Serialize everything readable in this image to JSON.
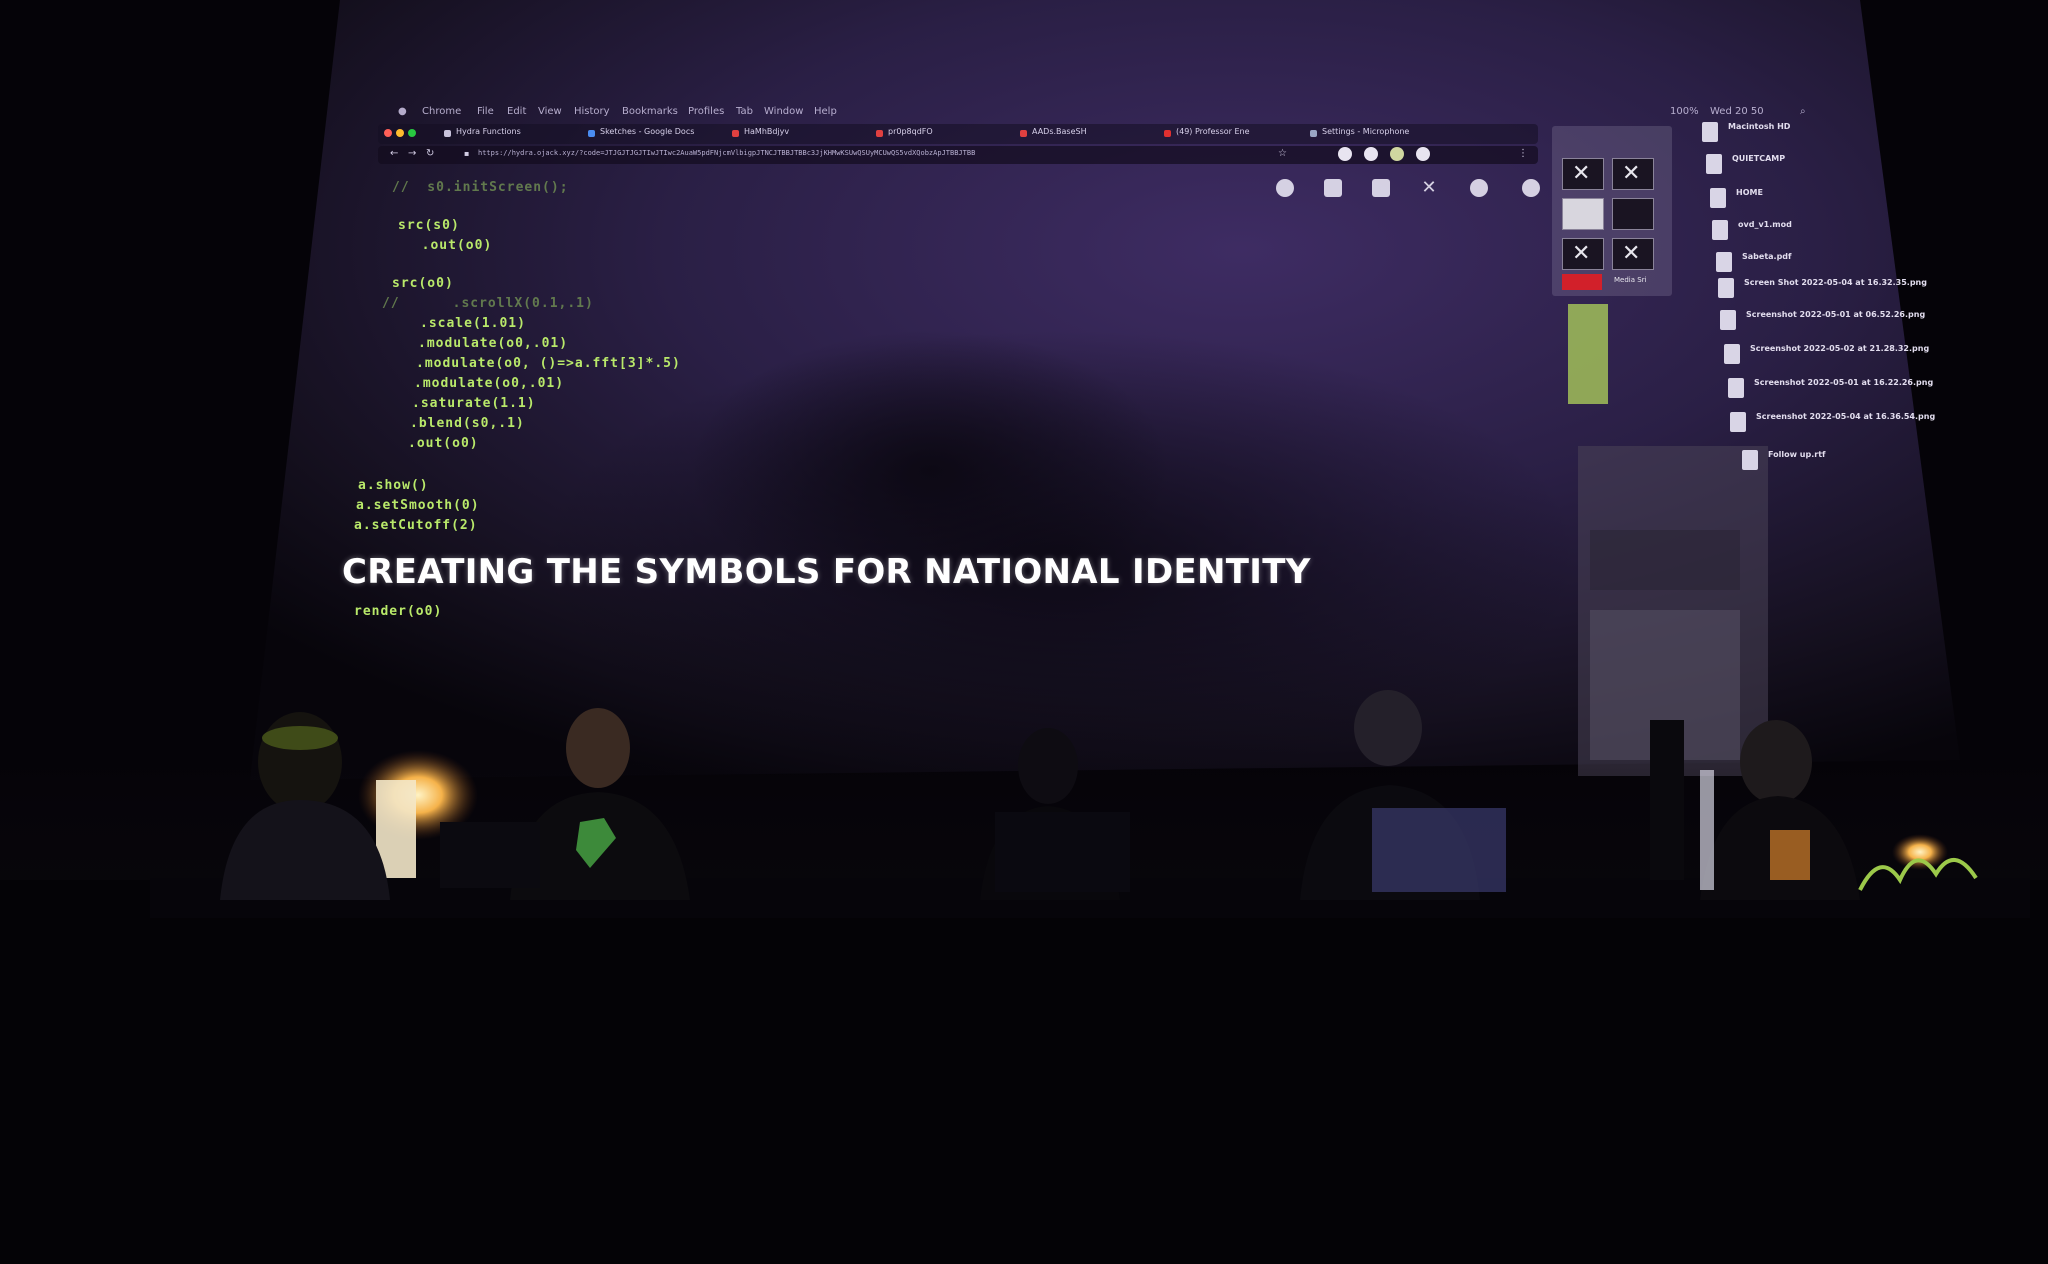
{
  "menubar": {
    "items": [
      "Chrome",
      "File",
      "Edit",
      "View",
      "History",
      "Bookmarks",
      "Profiles",
      "Tab",
      "Window",
      "Help"
    ],
    "status": [
      "100%",
      "Wed 20 50"
    ]
  },
  "browser": {
    "tabs": [
      "Hydra Functions",
      "Sketches - Google Docs",
      "HaMhBdjyv",
      "pr0p8qdFO",
      "AADs.BaseSH",
      "(49) Professor Ene",
      "Settings - Microphone"
    ],
    "url": "https://hydra.ojack.xyz/?code=JTJGJTJGJTIwJTIwc2AuaW5pdFNjcmVlbigpJTNCJTBBJTBBc3JjKHMwKSUwQSUyMCUwQS5vdXQobzApJTBBJTBB"
  },
  "code_lines": [
    {
      "t": "//  s0.initScreen();",
      "cls": "cm"
    },
    {
      "t": "src(s0)",
      "cls": "fn"
    },
    {
      "t": "  .out(o0)",
      "cls": "fn"
    },
    {
      "t": "src(o0)",
      "cls": "fn"
    },
    {
      "t": "//      .scrollX(0.1,.1)",
      "cls": "cm"
    },
    {
      "t": ".scale(1.01)",
      "cls": "fn"
    },
    {
      "t": ".modulate(o0,.01)",
      "cls": "fn"
    },
    {
      "t": ".modulate(o0, ()=>a.fft[3]*.5)",
      "cls": "fn"
    },
    {
      "t": ".modulate(o0,.01)",
      "cls": "fn"
    },
    {
      "t": ".saturate(1.1)",
      "cls": "fn"
    },
    {
      "t": ".blend(s0,.1)",
      "cls": "fn"
    },
    {
      "t": ".out(o0)",
      "cls": "fn"
    },
    {
      "t": "a.show()",
      "cls": "fn"
    },
    {
      "t": "a.setSmooth(0)",
      "cls": "fn"
    },
    {
      "t": "a.setCutoff(2)",
      "cls": "fn"
    },
    {
      "t": "render(o0)",
      "cls": "fn"
    }
  ],
  "overlay_text": "CREATING THE SYMBOLS FOR NATIONAL IDENTITY",
  "desktop_items": [
    "Macintosh HD",
    "QUIETCAMP",
    "HOME",
    "ovd_v1.mod",
    "Sabeta.pdf",
    "Screen Shot 2022-05-04 at 16.32.35.png",
    "Screenshot 2022-05-01 at 06.52.26.png",
    "Screenshot 2022-05-02 at 21.28.32.png",
    "Screenshot 2022-05-01 at 16.22.26.png",
    "Screenshot 2022-05-04 at 16.36.54.png",
    "Follow up.rtf"
  ],
  "finder": {
    "label": "Media Sri"
  },
  "colors": {
    "code_green": "#b9e96a",
    "screen_purple": "#3a2a5e",
    "background": "#050308"
  }
}
